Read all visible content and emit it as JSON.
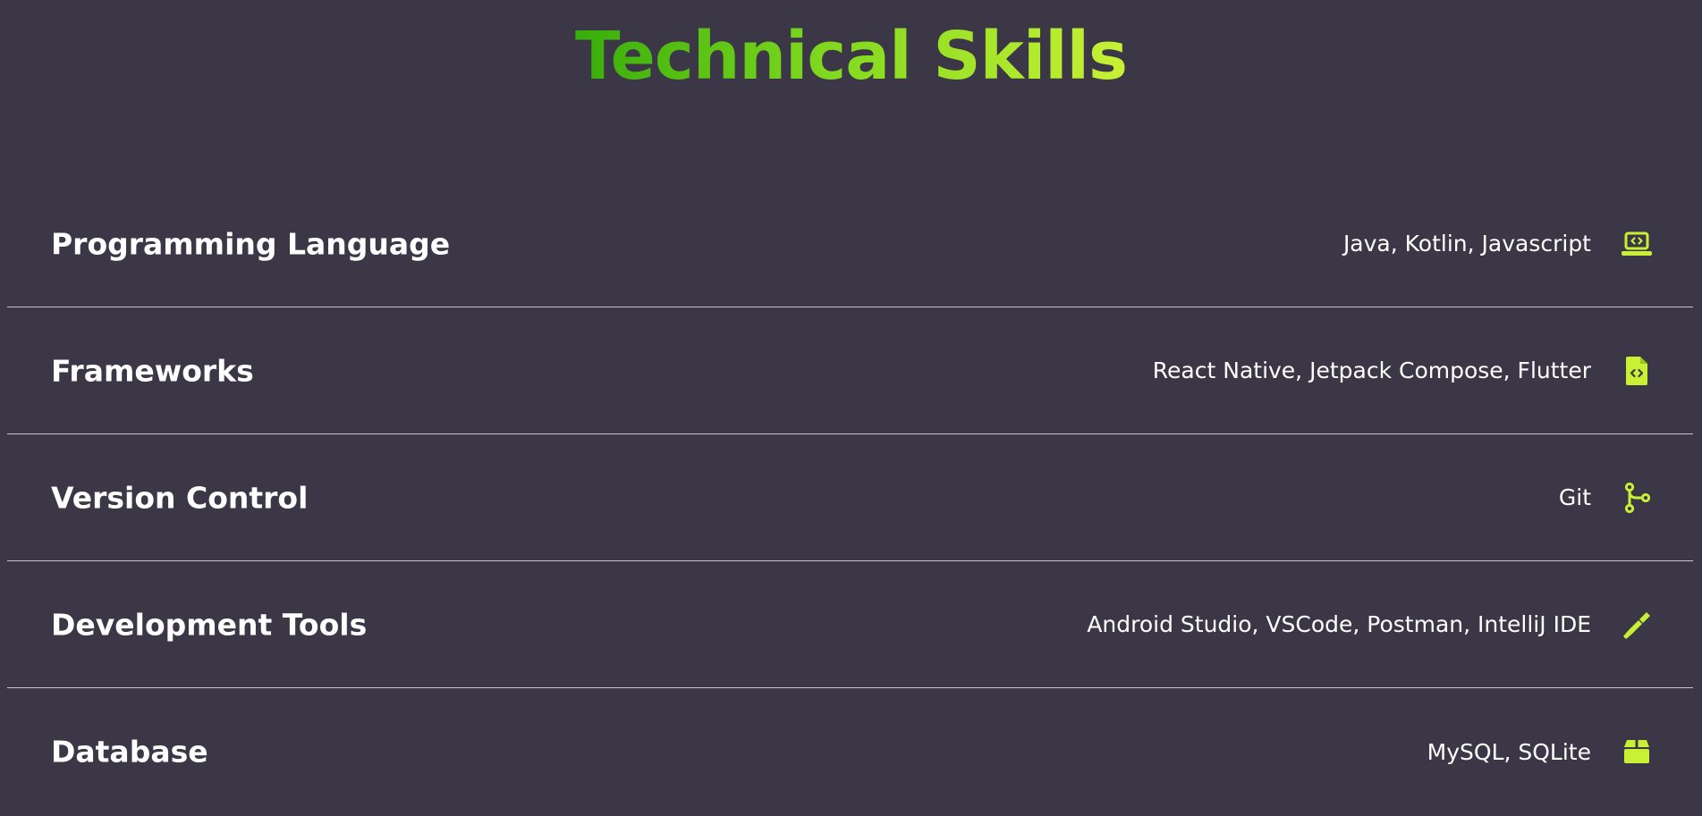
{
  "page": {
    "title": "Technical Skills"
  },
  "colors": {
    "background": "#3b3746",
    "accent": "#c8f135",
    "title_gradient_start": "#37ad0a",
    "title_gradient_end": "#c8f135",
    "divider": "#c8c6cf"
  },
  "skills": [
    {
      "label": "Programming Language",
      "value": "Java, Kotlin, Javascript",
      "icon": "laptop-code-icon"
    },
    {
      "label": "Frameworks",
      "value": "React Native, Jetpack Compose, Flutter",
      "icon": "file-code-icon"
    },
    {
      "label": "Version Control",
      "value": "Git",
      "icon": "code-branch-icon"
    },
    {
      "label": "Development Tools",
      "value": "Android Studio, VSCode, Postman, IntelliJ IDE",
      "icon": "screwdriver-icon"
    },
    {
      "label": "Database",
      "value": "MySQL, SQLite",
      "icon": "box-icon"
    }
  ]
}
